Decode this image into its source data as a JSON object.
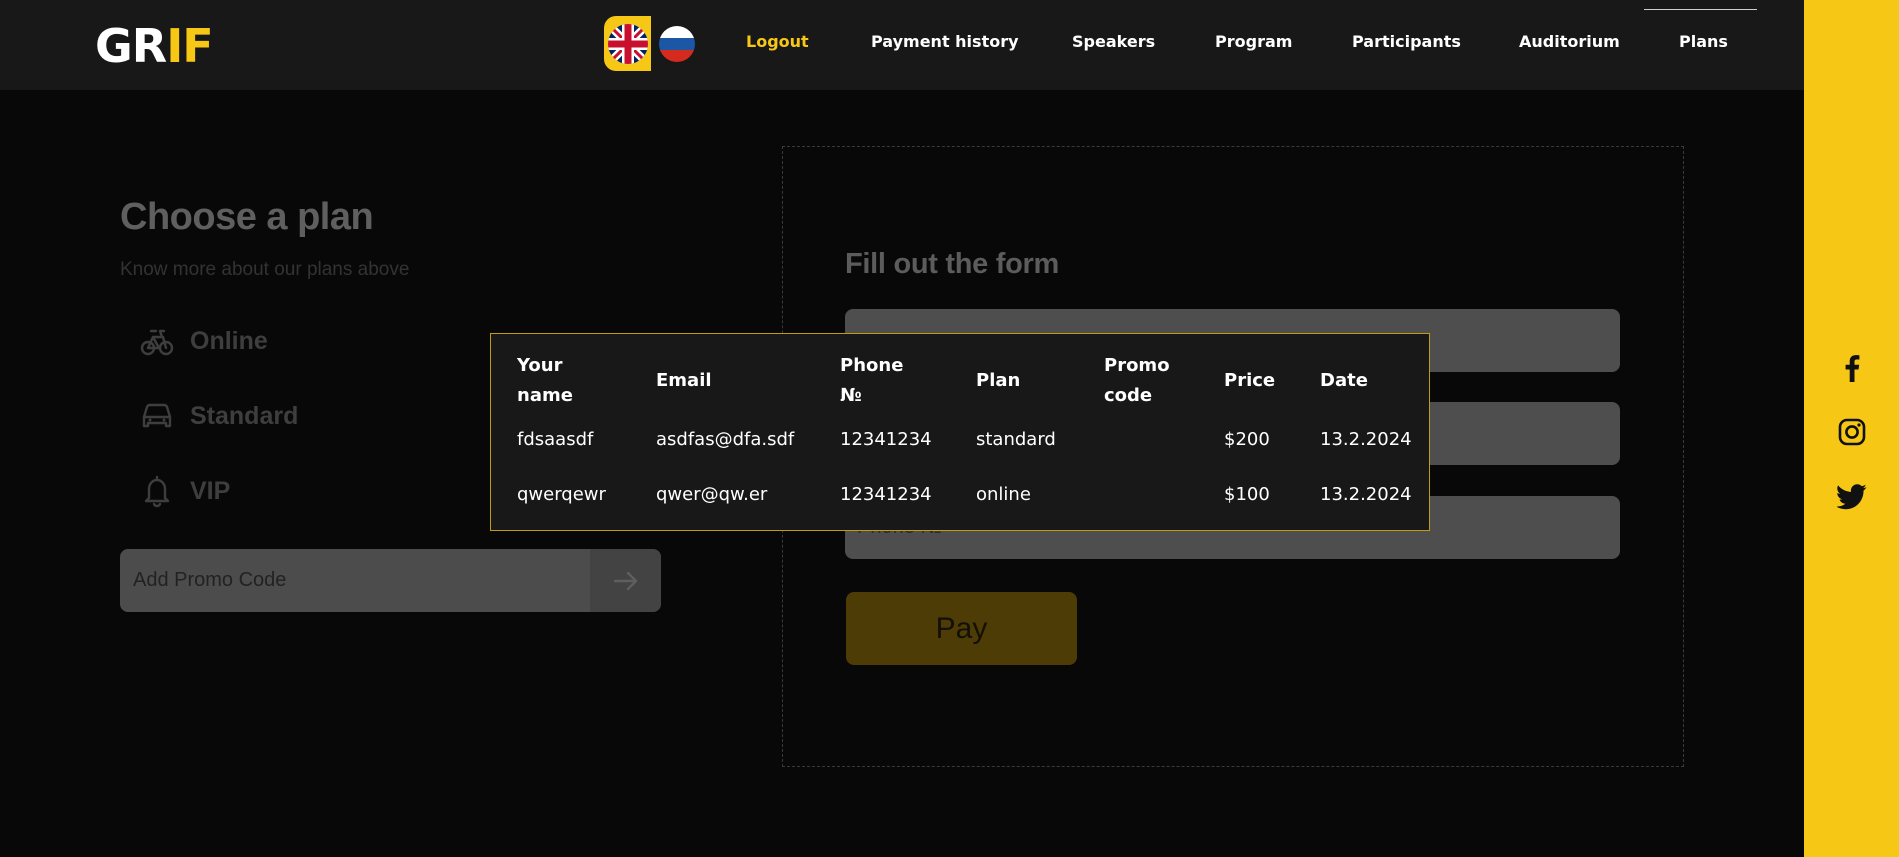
{
  "logo": {
    "part1": "GR",
    "part2": "IF"
  },
  "language": {
    "en_icon": "uk-flag-icon",
    "ru_icon": "russia-flag-icon"
  },
  "nav": {
    "logout": "Logout",
    "payment_history": "Payment history",
    "speakers": "Speakers",
    "program": "Program",
    "participants": "Participants",
    "auditorium": "Auditorium",
    "plans": "Plans"
  },
  "colors": {
    "accent": "#f7c716",
    "header_bg": "#181818",
    "page_bg": "#080808"
  },
  "plans_section": {
    "title": "Choose a plan",
    "subtitle": "Know more about our plans above",
    "plans": [
      {
        "label": "Online",
        "icon": "bicycle-icon"
      },
      {
        "label": "Standard",
        "icon": "car-icon"
      },
      {
        "label": "VIP",
        "icon": "bell-icon"
      }
    ],
    "promo_placeholder": "Add Promo Code",
    "promo_submit_icon": "arrow-right-icon"
  },
  "form": {
    "title": "Fill out the form",
    "phone_placeholder": "Phone №",
    "pay_label": "Pay"
  },
  "payment_table": {
    "headers": [
      "Your name",
      "Email",
      "Phone №",
      "Plan",
      "Promo code",
      "Price",
      "Date"
    ],
    "rows": [
      [
        "fdsaasdf",
        "asdfas@dfa.sdf",
        "12341234",
        "standard",
        "",
        "$200",
        "13.2.2024"
      ],
      [
        "qwerqewr",
        "qwer@qw.er",
        "12341234",
        "online",
        "",
        "$100",
        "13.2.2024"
      ]
    ]
  },
  "social": [
    "facebook-icon",
    "instagram-icon",
    "twitter-icon"
  ]
}
